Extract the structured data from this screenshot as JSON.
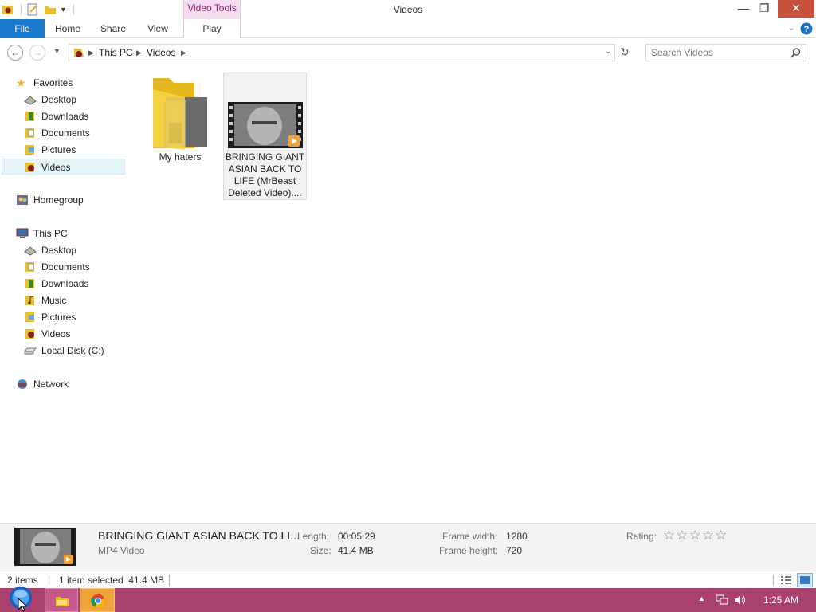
{
  "window": {
    "title": "Videos",
    "contextual_tab_group": "Video Tools",
    "controls": {
      "minimize": "—",
      "maximize": "❐",
      "close": "✕"
    },
    "accent": "#1979ca",
    "contextual_color": "#f6dcf0"
  },
  "ribbon": {
    "tabs": [
      {
        "label": "File"
      },
      {
        "label": "Home"
      },
      {
        "label": "Share"
      },
      {
        "label": "View"
      },
      {
        "label": "Play"
      }
    ]
  },
  "address": {
    "crumbs": [
      "This PC",
      "Videos"
    ],
    "search_placeholder": "Search Videos"
  },
  "nav": {
    "favorites": {
      "label": "Favorites",
      "items": [
        "Desktop",
        "Downloads",
        "Documents",
        "Pictures",
        "Videos"
      ]
    },
    "homegroup": "Homegroup",
    "this_pc": {
      "label": "This PC",
      "items": [
        "Desktop",
        "Documents",
        "Downloads",
        "Music",
        "Pictures",
        "Videos",
        "Local Disk (C:)"
      ]
    },
    "network": "Network"
  },
  "content": {
    "items": [
      {
        "name": "My haters",
        "kind": "folder-icon"
      },
      {
        "name_lines": [
          "BRINGING GIANT",
          "ASIAN BACK TO",
          "LIFE (MrBeast",
          "Deleted Video)...."
        ],
        "kind": "video-thumbnail"
      }
    ]
  },
  "details": {
    "title": "BRINGING GIANT ASIAN BACK TO LI...",
    "type": "MP4 Video",
    "length_label": "Length:",
    "length": "00:05:29",
    "size_label": "Size:",
    "size": "41.4 MB",
    "frame_width_label": "Frame width:",
    "frame_width": "1280",
    "frame_height_label": "Frame height:",
    "frame_height": "720",
    "rating_label": "Rating:",
    "rating_stars": "☆☆☆☆☆"
  },
  "status": {
    "count": "2 items",
    "selection": "1 item selected  41.4 MB"
  },
  "taskbar": {
    "clock": "1:25 AM",
    "color": "#a8416d"
  }
}
